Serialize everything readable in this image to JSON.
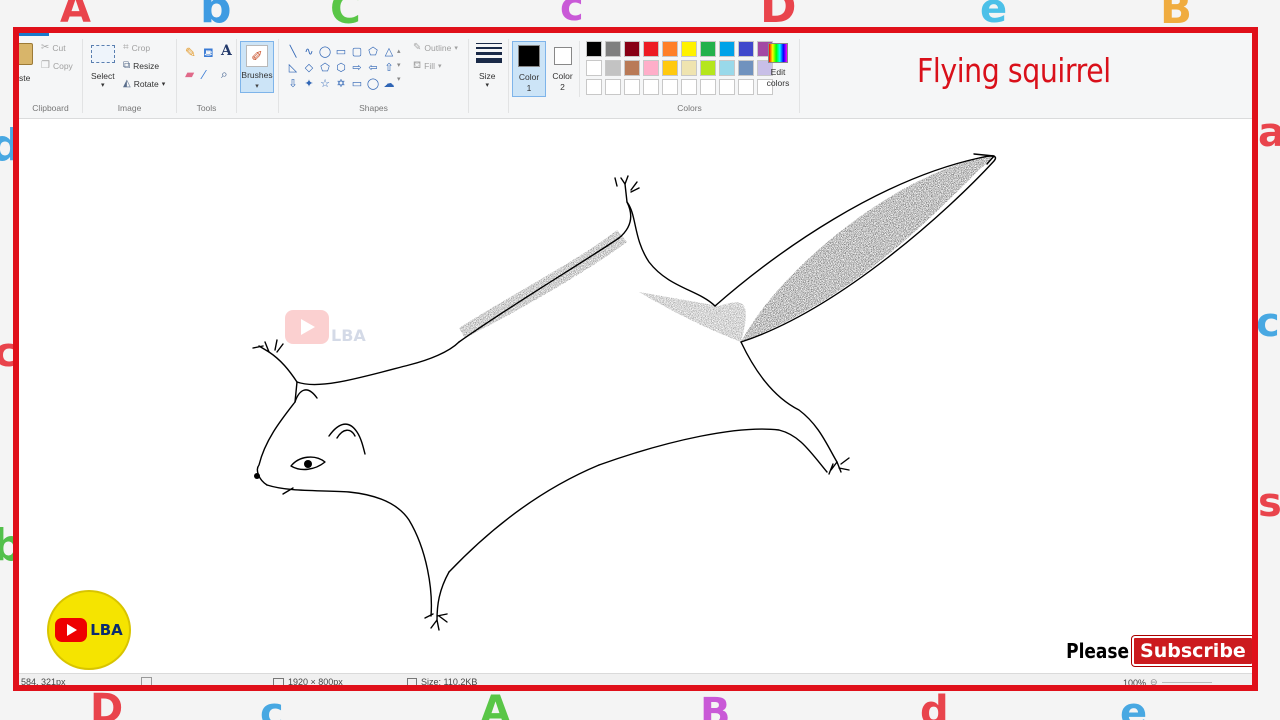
{
  "ribbon": {
    "clipboard": {
      "paste": "ste",
      "cut": "Cut",
      "copy": "Copy",
      "label": "Clipboard"
    },
    "image": {
      "select": "Select",
      "crop": "Crop",
      "resize": "Resize",
      "rotate": "Rotate",
      "label": "Image"
    },
    "tools": {
      "label": "Tools"
    },
    "brushes": {
      "label": "Brushes"
    },
    "shapes": {
      "outline": "Outline",
      "fill": "Fill",
      "label": "Shapes"
    },
    "size": {
      "label": "Size"
    },
    "color1": {
      "label": "Color",
      "num": "1",
      "value": "#000000"
    },
    "color2": {
      "label": "Color",
      "num": "2",
      "value": "#ffffff"
    },
    "colors": {
      "label": "Colors",
      "row1": [
        "#000000",
        "#7f7f7f",
        "#880015",
        "#ed1c24",
        "#ff7f27",
        "#fff200",
        "#22b14c",
        "#00a2e8",
        "#3f48cc",
        "#a349a4"
      ],
      "row2": [
        "#ffffff",
        "#c3c3c3",
        "#b97a57",
        "#ffaec9",
        "#ffc90e",
        "#efe4b0",
        "#b5e61d",
        "#99d9ea",
        "#7092be",
        "#c8bfe7"
      ],
      "row3": [
        "#ffffff",
        "#ffffff",
        "#ffffff",
        "#ffffff",
        "#ffffff",
        "#ffffff",
        "#ffffff",
        "#ffffff",
        "#ffffff",
        "#ffffff"
      ]
    },
    "edit_colors": {
      "line1": "Edit",
      "line2": "colors"
    }
  },
  "overlay": {
    "title": "Flying squirrel",
    "please": "Please",
    "subscribe": "Subscribe",
    "logo_text": "LBA",
    "watermark": "LBA"
  },
  "status": {
    "cursor": "584, 321px",
    "dimensions": "1920 × 800px",
    "size": "Size: 110.2KB",
    "zoom": "100%"
  }
}
